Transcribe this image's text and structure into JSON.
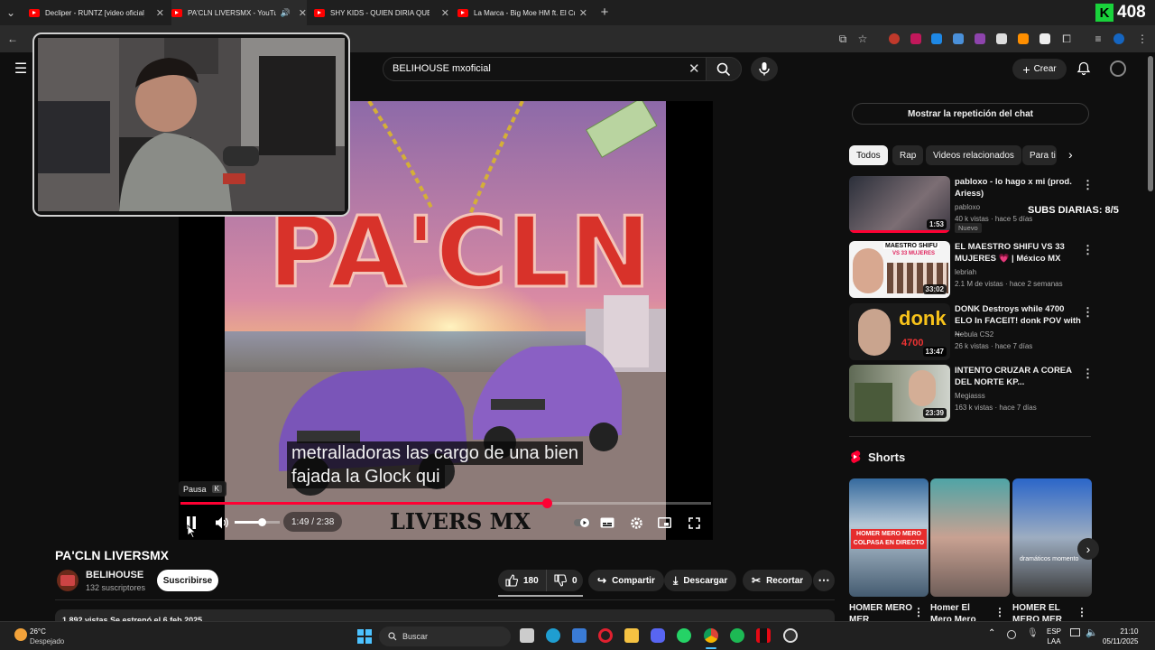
{
  "browser": {
    "tabs": [
      {
        "title": "Decliper - RUNTZ [video oficial]"
      },
      {
        "title": "PA'CLN LIVERSMX - YouTube"
      },
      {
        "title": "SHY KIDS - QUIEN DIRIA QUE ESTAS"
      },
      {
        "title": "La Marca - Big Moe HM ft. El Cr"
      }
    ],
    "new_tab": "+"
  },
  "counter": {
    "letter": "K",
    "value": "408"
  },
  "search": {
    "query": "BELIHOUSE mxoficial"
  },
  "header": {
    "create_label": "Crear"
  },
  "player": {
    "caption_line1": "metralladoras las cargo de una bien",
    "caption_line2": "fajada la Glock qui",
    "tooltip_label": "Pausa",
    "tooltip_key": "K",
    "time": "1:49 / 2:38",
    "progress": 0.69,
    "volume": 0.6,
    "cover_title": "PA'CLN",
    "cover_footer": "LIVERS MX"
  },
  "video": {
    "title": "PA'CLN LIVERSMX",
    "channel": "BELIHOUSE",
    "subscribers": "132 suscriptores",
    "subscribe_label": "Suscribirse",
    "likes": "180",
    "dislikes": "0",
    "share_label": "Compartir",
    "download_label": "Descargar",
    "clip_label": "Recortar",
    "description": "1.892 vistas  Se estrenó el 6 feb 2025"
  },
  "sidebar": {
    "chat_replay": "Mostrar la repetición del chat",
    "chips": [
      "Todos",
      "Rap",
      "Videos relacionados",
      "Para ti"
    ],
    "related": [
      {
        "title": "pabloxo - lo hago x mi (prod. Ariess)",
        "channel": "pabloxo",
        "meta": "40 k vistas · hace 5 días",
        "duration": "1:53",
        "badge": "Nuevo"
      },
      {
        "title": "EL MAESTRO SHIFU VS 33 MUJERES 💗 | México MX",
        "channel": "lebriah",
        "meta": "2.1 M de vistas · hace 2 semanas",
        "duration": "33:02"
      },
      {
        "title": "DONK Destroys while 4700 ELO In FACEIT! donk POV with ...",
        "channel": "Nebula CS2",
        "meta": "26 k vistas · hace 7 días",
        "duration": "13:47"
      },
      {
        "title": "INTENTO CRUZAR A COREA DEL NORTE KP...",
        "channel": "Megiasss",
        "meta": "163 k vistas · hace 7 días",
        "duration": "23:39"
      }
    ],
    "subs_overlay": "SUBS DIARIAS: 8/5",
    "shorts_label": "Shorts",
    "shorts": [
      {
        "title": "HOMER MERO MER",
        "caption": "HOMER MERO MERO COLPASA EN DIRECTO"
      },
      {
        "title": "Homer El Mero Mero"
      },
      {
        "title": "HOMER EL MERO MER",
        "caption": "dramáticos momento"
      }
    ],
    "thumb_texts": {
      "shifu_top": "MAESTRO SHIFU",
      "shifu_sub": "VS 33 MUJERES",
      "donk": "donk",
      "elo": "4700"
    }
  },
  "taskbar": {
    "temp": "26°C",
    "weather": "Despejado",
    "search": "Buscar",
    "lang1": "ESP",
    "lang2": "LAA",
    "time": "21:10",
    "date": "05/11/2025"
  }
}
